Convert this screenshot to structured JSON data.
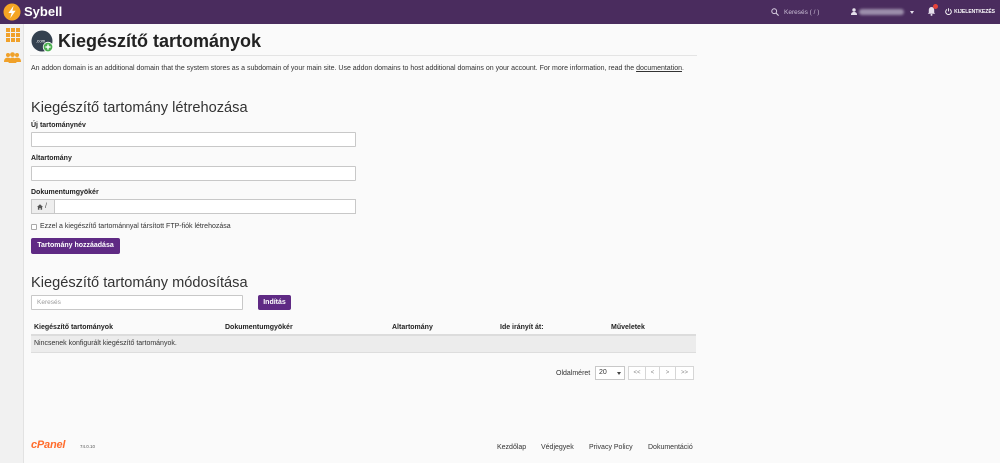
{
  "app": {
    "brand": "Sybell"
  },
  "topbar": {
    "search_placeholder": "Keresés ( / )",
    "logout_label": "KIJELENTKEZÉS"
  },
  "page": {
    "icon_text": ".com",
    "title": "Kiegészítő tartományok",
    "description": "An addon domain is an additional domain that the system stores as a subdomain of your main site. Use addon domains to host additional domains on your account. For more information, read the ",
    "description_link": "documentation",
    "description_end": "."
  },
  "create": {
    "heading": "Kiegészítő tartomány létrehozása",
    "new_domain_label": "Új tartománynév",
    "new_domain_value": "",
    "subdomain_label": "Altartomány",
    "subdomain_value": "",
    "docroot_label": "Dokumentumgyökér",
    "docroot_prefix": "/",
    "docroot_value": "",
    "ftp_checkbox_label": "Ezzel a kiegészítő tartománnyal társított FTP-fiók létrehozása",
    "ftp_checked": false,
    "submit_label": "Tartomány hozzáadása"
  },
  "modify": {
    "heading": "Kiegészítő tartomány módosítása",
    "search_placeholder": "Keresés",
    "search_button": "Indítás",
    "columns": [
      "Kiegészítő tartományok",
      "Dokumentumgyökér",
      "Altartomány",
      "Ide irányít át:",
      "Műveletek"
    ],
    "empty_message": "Nincsenek konfigurált kiegészítő tartományok.",
    "page_size_label": "Oldalméret",
    "page_size": "20",
    "pager": [
      "<<",
      "<",
      ">",
      ">>"
    ]
  },
  "footer": {
    "logo": "cPanel",
    "version": "74.0.10",
    "links": [
      "Kezdőlap",
      "Védjegyek",
      "Privacy Policy",
      "Dokumentáció"
    ]
  },
  "icons": {
    "brand": "brand-logo-icon",
    "top_search": "search-icon",
    "user": "user-icon",
    "notifications": "bell-icon",
    "logout": "logout-icon",
    "sidebar_tools": "grid-icon",
    "sidebar_users": "users-icon",
    "page": "addon-domain-icon",
    "docroot": "home-icon"
  },
  "colors": {
    "topbar": "#4a2c5e",
    "accent": "#5f2a84",
    "brand": "#f5a524",
    "sidebar_icons": "#f0a12a",
    "cpanel": "#ff6c2c",
    "notification_badge": "#e5433a"
  }
}
